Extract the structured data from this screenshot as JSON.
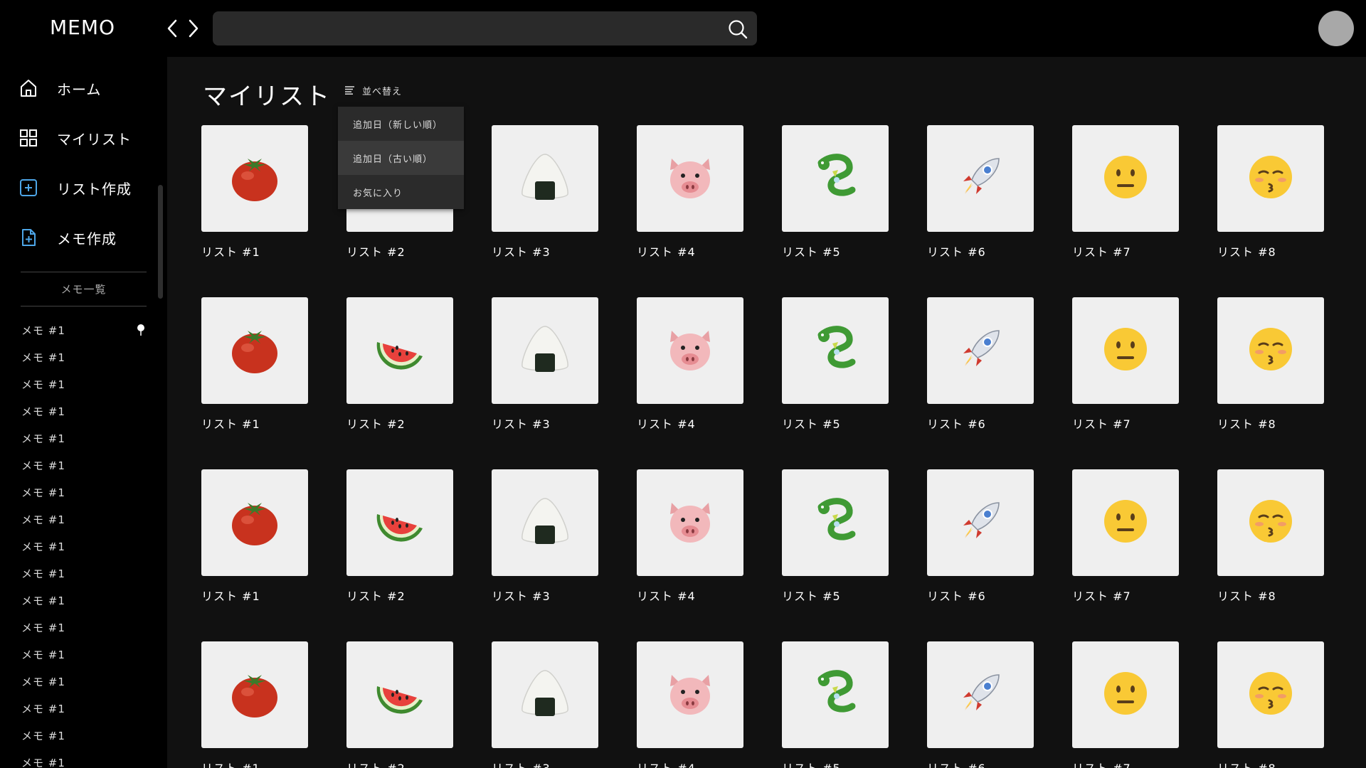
{
  "header": {
    "logo": "MEMO",
    "search": {
      "value": "",
      "placeholder": ""
    }
  },
  "sidebar": {
    "nav": [
      {
        "label": "ホーム",
        "icon": "home-icon"
      },
      {
        "label": "マイリスト",
        "icon": "grid-icon"
      },
      {
        "label": "リスト作成",
        "icon": "add-square-icon"
      },
      {
        "label": "メモ作成",
        "icon": "add-document-icon"
      }
    ],
    "memo_header": "メモ一覧",
    "memos": [
      "メモ #1",
      "メモ #1",
      "メモ #1",
      "メモ #1",
      "メモ #1",
      "メモ #1",
      "メモ #1",
      "メモ #1",
      "メモ #1",
      "メモ #1",
      "メモ #1",
      "メモ #1",
      "メモ #1",
      "メモ #1",
      "メモ #1",
      "メモ #1",
      "メモ #1"
    ]
  },
  "main": {
    "title": "マイリスト",
    "sort": {
      "label": "並べ替え",
      "options": [
        "追加日（新しい順）",
        "追加日（古い順）",
        "お気に入り"
      ],
      "highlighted_index": 1
    },
    "items": [
      {
        "label": "リスト #1",
        "icon": "tomato-icon"
      },
      {
        "label": "リスト #2",
        "icon": "watermelon-icon"
      },
      {
        "label": "リスト #3",
        "icon": "rice-ball-icon"
      },
      {
        "label": "リスト #4",
        "icon": "pig-face-icon"
      },
      {
        "label": "リスト #5",
        "icon": "dragon-icon"
      },
      {
        "label": "リスト #6",
        "icon": "rocket-icon"
      },
      {
        "label": "リスト #7",
        "icon": "neutral-face-icon"
      },
      {
        "label": "リスト #8",
        "icon": "kissing-face-icon"
      }
    ],
    "row_count": 4
  }
}
